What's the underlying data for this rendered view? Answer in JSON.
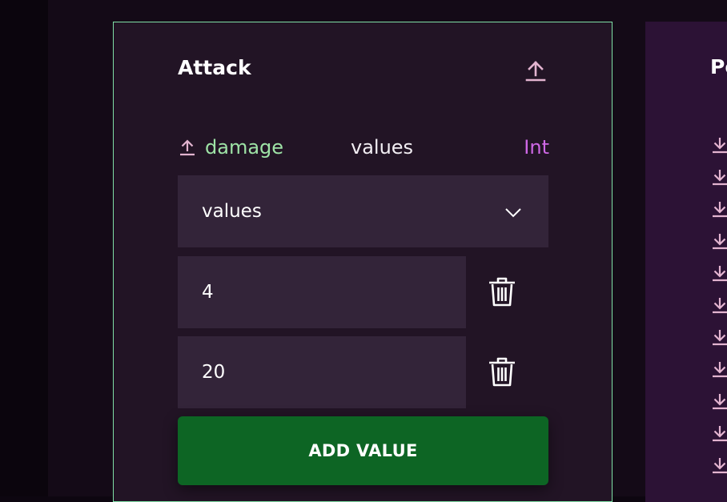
{
  "node": {
    "title": "Attack",
    "port": {
      "name": "damage",
      "label": "values",
      "type": "Int"
    },
    "select": {
      "value": "values"
    },
    "values": [
      "4",
      "20"
    ],
    "add_button": "ADD VALUE"
  },
  "right_node": {
    "title_partial": "Po",
    "input_port_count": 11
  },
  "colors": {
    "port_name": "#9ee3a6",
    "type_accent": "#cf68e6",
    "card_border": "#7fe0a6",
    "add_button": "#0d6524",
    "icon_pink": "#e3b4d0"
  },
  "icons": {
    "export": "upload-arrow-icon",
    "port": "upload-arrow-icon",
    "chevron": "chevron-down-icon",
    "delete": "trash-icon",
    "input_port": "download-arrow-icon"
  }
}
